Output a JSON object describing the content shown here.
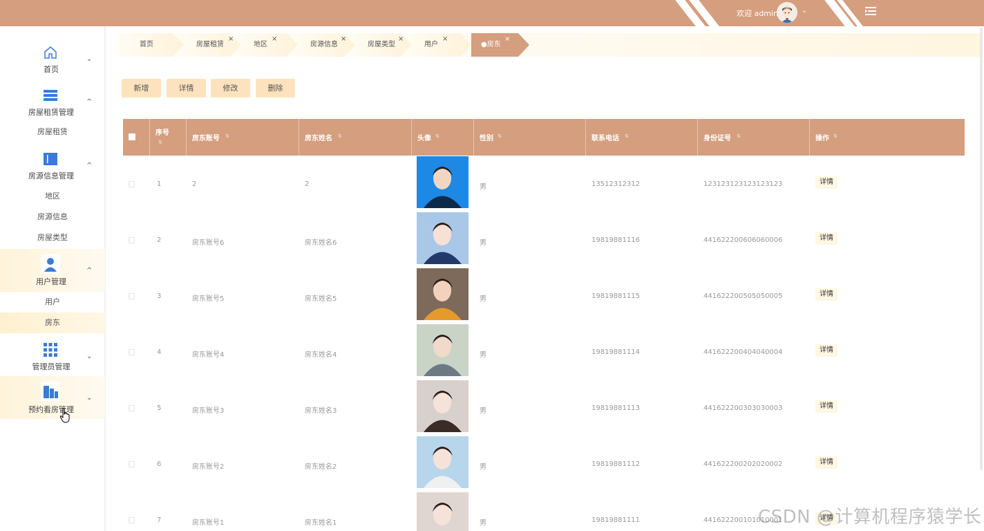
{
  "header": {
    "welcome": "欢迎 admin",
    "colors": {
      "bar": "#d59e7e",
      "accent_light": "#fde3bd"
    },
    "menu_icon": "hamburger-icon",
    "avatar_icon": "user-avatar-icon",
    "caret_icon": "chevron-down-icon"
  },
  "sidebar": {
    "groups": [
      {
        "label": "首页",
        "icon": "home-icon",
        "expanded": false
      },
      {
        "label": "房屋租赁管理",
        "icon": "list-icon",
        "expanded": true,
        "items": [
          "房屋租赁"
        ]
      },
      {
        "label": "房源信息管理",
        "icon": "book-icon",
        "expanded": true,
        "items": [
          "地区",
          "房源信息",
          "房屋类型"
        ]
      },
      {
        "label": "用户管理",
        "icon": "person-icon",
        "expanded": true,
        "items": [
          "用户",
          "房东"
        ]
      },
      {
        "label": "管理员管理",
        "icon": "grid-icon",
        "expanded": false
      },
      {
        "label": "预约看房管理",
        "icon": "building-icon",
        "expanded": false
      }
    ]
  },
  "tabs": [
    {
      "label": "首页",
      "closable": false
    },
    {
      "label": "房屋租赁",
      "closable": true
    },
    {
      "label": "地区",
      "closable": true
    },
    {
      "label": "房源信息",
      "closable": true
    },
    {
      "label": "房屋类型",
      "closable": true
    },
    {
      "label": "用户",
      "closable": true
    },
    {
      "label": "●房东",
      "closable": true,
      "active": true
    }
  ],
  "toolbar": {
    "add": "新增",
    "detail": "详情",
    "edit": "修改",
    "delete": "删除"
  },
  "table": {
    "columns": [
      "序号",
      "房东账号",
      "房东姓名",
      "头像",
      "性别",
      "联系电话",
      "身份证号",
      "操作"
    ],
    "rows": [
      {
        "no": "1",
        "account": "2",
        "name": "2",
        "gender": "男",
        "phone": "13512312312",
        "id_card": "123123123123123123",
        "action": "详情"
      },
      {
        "no": "2",
        "account": "房东账号6",
        "name": "房东姓名6",
        "gender": "男",
        "phone": "19819881116",
        "id_card": "441622200606060006",
        "action": "详情"
      },
      {
        "no": "3",
        "account": "房东账号5",
        "name": "房东姓名5",
        "gender": "男",
        "phone": "19819881115",
        "id_card": "441622200505050005",
        "action": "详情"
      },
      {
        "no": "4",
        "account": "房东账号4",
        "name": "房东姓名4",
        "gender": "男",
        "phone": "19819881114",
        "id_card": "441622200404040004",
        "action": "详情"
      },
      {
        "no": "5",
        "account": "房东账号3",
        "name": "房东姓名3",
        "gender": "男",
        "phone": "19819881113",
        "id_card": "441622200303030003",
        "action": "详情"
      },
      {
        "no": "6",
        "account": "房东账号2",
        "name": "房东姓名2",
        "gender": "男",
        "phone": "19819881112",
        "id_card": "441622200202020002",
        "action": "详情"
      },
      {
        "no": "7",
        "account": "房东账号1",
        "name": "房东姓名1",
        "gender": "男",
        "phone": "19819881111",
        "id_card": "441622200101010001",
        "action": "详情"
      }
    ]
  },
  "watermark": "CSDN @计算机程序猿学长"
}
